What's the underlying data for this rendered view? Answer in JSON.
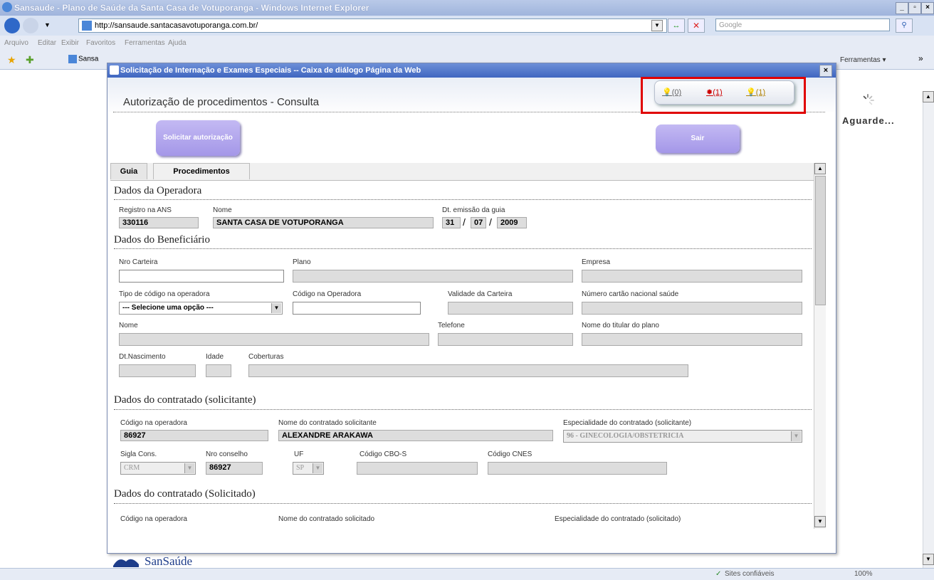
{
  "browser": {
    "title": "Sansaude - Plano de Saúde da Santa Casa de Votuporanga - Windows Internet Explorer",
    "url": "http://sansaude.santacasavotuporanga.com.br/",
    "search_placeholder": "Google",
    "menu": [
      "Arquivo",
      "Editar",
      "Exibir",
      "Favoritos",
      "Ferramentas",
      "Ajuda"
    ],
    "fav_tab": "Sansa",
    "tools_label": "Ferramentas",
    "waiting_text": "Aguarde...",
    "status_trusted": "Sites confiáveis",
    "zoom": "100%"
  },
  "dialog": {
    "title": "Solicitação de Internação e Exames Especiais -- Caixa de diálogo Página da Web",
    "page_title": "Autorização de procedimentos - Consulta",
    "request_button": "Solicitar autorização",
    "exit_button": "Sair",
    "notifications": [
      "(0)",
      "(1)",
      "(1)"
    ],
    "tabs": [
      "Guia",
      "Procedimentos"
    ],
    "footer_logo": "SanSaúde"
  },
  "operadora": {
    "section": "Dados da Operadora",
    "registro_label": "Registro na ANS",
    "registro_value": "330116",
    "nome_label": "Nome",
    "nome_value": "SANTA CASA DE VOTUPORANGA",
    "emissao_label": "Dt. emissão da guia",
    "emissao_day": "31",
    "emissao_month": "07",
    "emissao_year": "2009"
  },
  "beneficiario": {
    "section": "Dados do Beneficiário",
    "carteira_label": "Nro Carteira",
    "plano_label": "Plano",
    "empresa_label": "Empresa",
    "tipo_codigo_label": "Tipo de código na operadora",
    "tipo_codigo_value": "--- Selecione uma opção ---",
    "codigo_operadora_label": "Código na Operadora",
    "validade_label": "Validade da Carteira",
    "cartao_label": "Número cartão nacional saúde",
    "nome_label": "Nome",
    "telefone_label": "Telefone",
    "titular_label": "Nome do titular do plano",
    "nascimento_label": "Dt.Nascimento",
    "idade_label": "Idade",
    "coberturas_label": "Coberturas"
  },
  "solicitante": {
    "section": "Dados do contratado (solicitante)",
    "codigo_label": "Código na operadora",
    "codigo_value": "86927",
    "nome_label": "Nome do contratado solicitante",
    "nome_value": "ALEXANDRE ARAKAWA",
    "especialidade_label": "Especialidade do contratado (solicitante)",
    "especialidade_value": "96 - GINECOLOGIA/OBSTETRICIA",
    "sigla_label": "Sigla Cons.",
    "sigla_value": "CRM",
    "conselho_label": "Nro conselho",
    "conselho_value": "86927",
    "uf_label": "UF",
    "uf_value": "SP",
    "cbo_label": "Código CBO-S",
    "cnes_label": "Código CNES"
  },
  "solicitado": {
    "section": "Dados do contratado (Solicitado)",
    "codigo_label": "Código na operadora",
    "nome_label": "Nome do contratado solicitado",
    "especialidade_label": "Especialidade do contratado (solicitado)"
  }
}
